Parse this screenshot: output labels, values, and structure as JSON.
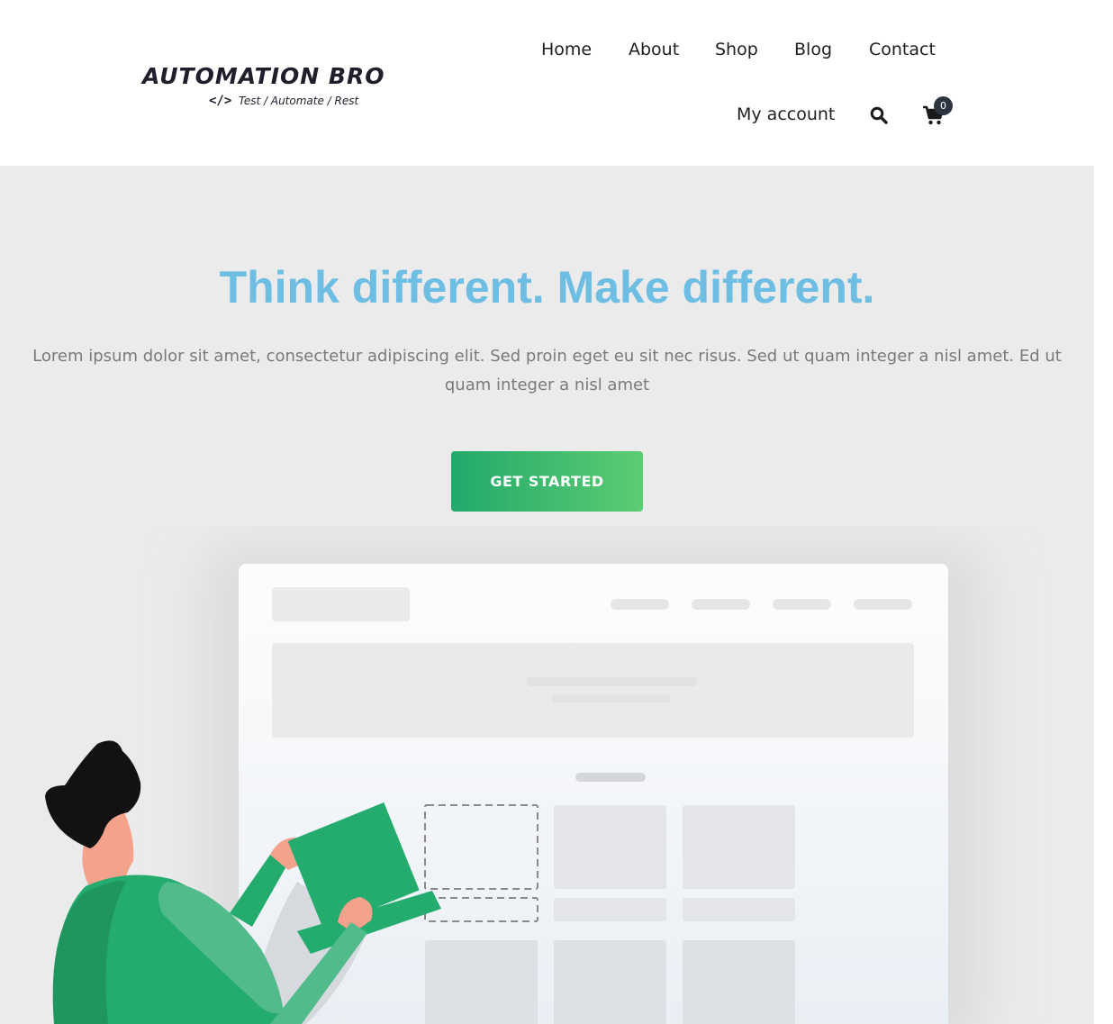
{
  "site": {
    "logo_title": "AUTOMATION BRO",
    "logo_code": "</>",
    "logo_tagline": "Test / Automate / Rest"
  },
  "nav": {
    "items": [
      {
        "label": "Home"
      },
      {
        "label": "About"
      },
      {
        "label": "Shop"
      },
      {
        "label": "Blog"
      },
      {
        "label": "Contact"
      },
      {
        "label": "My account"
      }
    ],
    "search_icon": "search-icon",
    "cart_icon": "cart-icon",
    "cart_count": "0"
  },
  "hero": {
    "title": "Think different. Make different.",
    "text": "Lorem ipsum dolor sit amet, consectetur adipiscing elit. Sed proin eget eu sit nec risus. Sed ut quam integer a nisl amet.  Ed ut quam integer a nisl amet",
    "cta_label": "GET STARTED"
  },
  "colors": {
    "title": "#6ebee3",
    "cta_start": "#22a96b",
    "cta_end": "#5ccc72",
    "hero_bg": "#ebebeb",
    "figure_green": "#24ab6e"
  }
}
